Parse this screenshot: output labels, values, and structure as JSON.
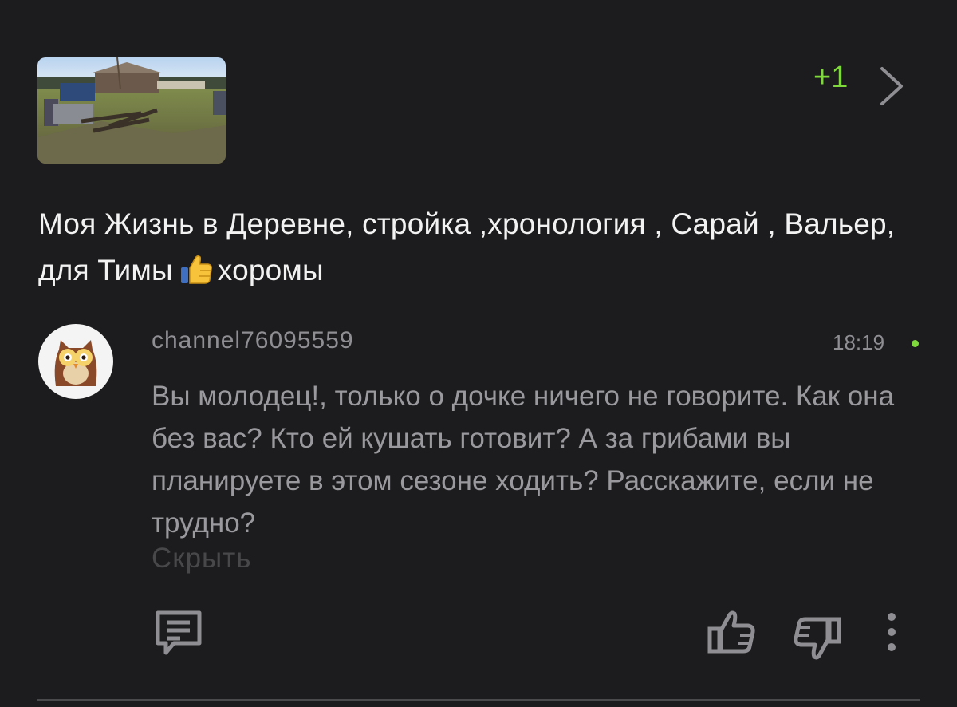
{
  "video": {
    "title_part1": "Моя Жизнь в Деревне,  стройка ,хронология , Сарай , Вальер,  для Тимы",
    "title_part2": "хоромы",
    "thumbs_up_emoji": "thumbs-up-emoji"
  },
  "rating_delta": "+1",
  "comment": {
    "author": "channel76095559",
    "time": "18:19",
    "text": "Вы молодец!, только о дочке ничего не говорите. Как она без вас? Кто ей кушать готовит? А за грибами вы планируете в этом сезоне ходить? Расскажите, если не трудно?",
    "hide_label": "Скрыть"
  },
  "icons": {
    "reply": "comment-icon",
    "like": "thumb-up-icon",
    "dislike": "thumb-down-icon",
    "more": "more-vertical-icon",
    "next": "chevron-right-icon"
  },
  "colors": {
    "background": "#1c1c1e",
    "accent": "#7fd93c",
    "text_primary": "#f2f2f2",
    "text_secondary": "#9a9a9e"
  }
}
